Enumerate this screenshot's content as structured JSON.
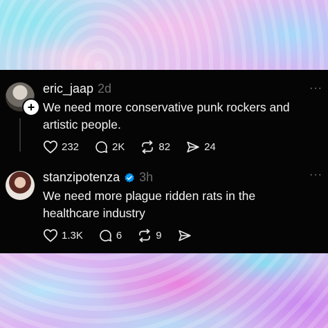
{
  "posts": [
    {
      "username": "eric_jaap",
      "time": "2d",
      "verified": false,
      "text": "We need more conservative punk rockers and artistic people.",
      "likes": "232",
      "replies": "2K",
      "reposts": "82",
      "shares": "24",
      "has_follow_badge": true
    },
    {
      "username": "stanzipotenza",
      "time": "3h",
      "verified": true,
      "text": "We need more plague ridden rats in the healthcare industry",
      "likes": "1.3K",
      "replies": "6",
      "reposts": "9",
      "shares": ""
    }
  ],
  "more_icon": "···",
  "follow_icon": "+",
  "colors": {
    "panel_bg": "#050505",
    "text": "#f2f2f2",
    "muted": "#6c6c6c",
    "verified": "#0095f6"
  }
}
